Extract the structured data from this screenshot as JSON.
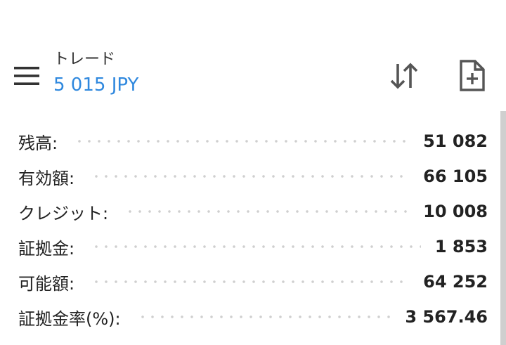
{
  "header": {
    "title": "トレード",
    "deposit": "5 015 JPY"
  },
  "icons": {
    "menu": "hamburger-menu-icon",
    "sort": "sort-arrows-icon",
    "new_order": "new-document-icon"
  },
  "colors": {
    "accent": "#2f88de",
    "icon": "#555555",
    "text": "#222222"
  },
  "account": {
    "rows": [
      {
        "label": "残高:",
        "value": "51 082"
      },
      {
        "label": "有効額:",
        "value": "66 105"
      },
      {
        "label": "クレジット:",
        "value": "10 008"
      },
      {
        "label": "証拠金:",
        "value": "1 853"
      },
      {
        "label": "可能額:",
        "value": "64 252"
      },
      {
        "label": "証拠金率(%):",
        "value": "3 567.46"
      }
    ]
  }
}
